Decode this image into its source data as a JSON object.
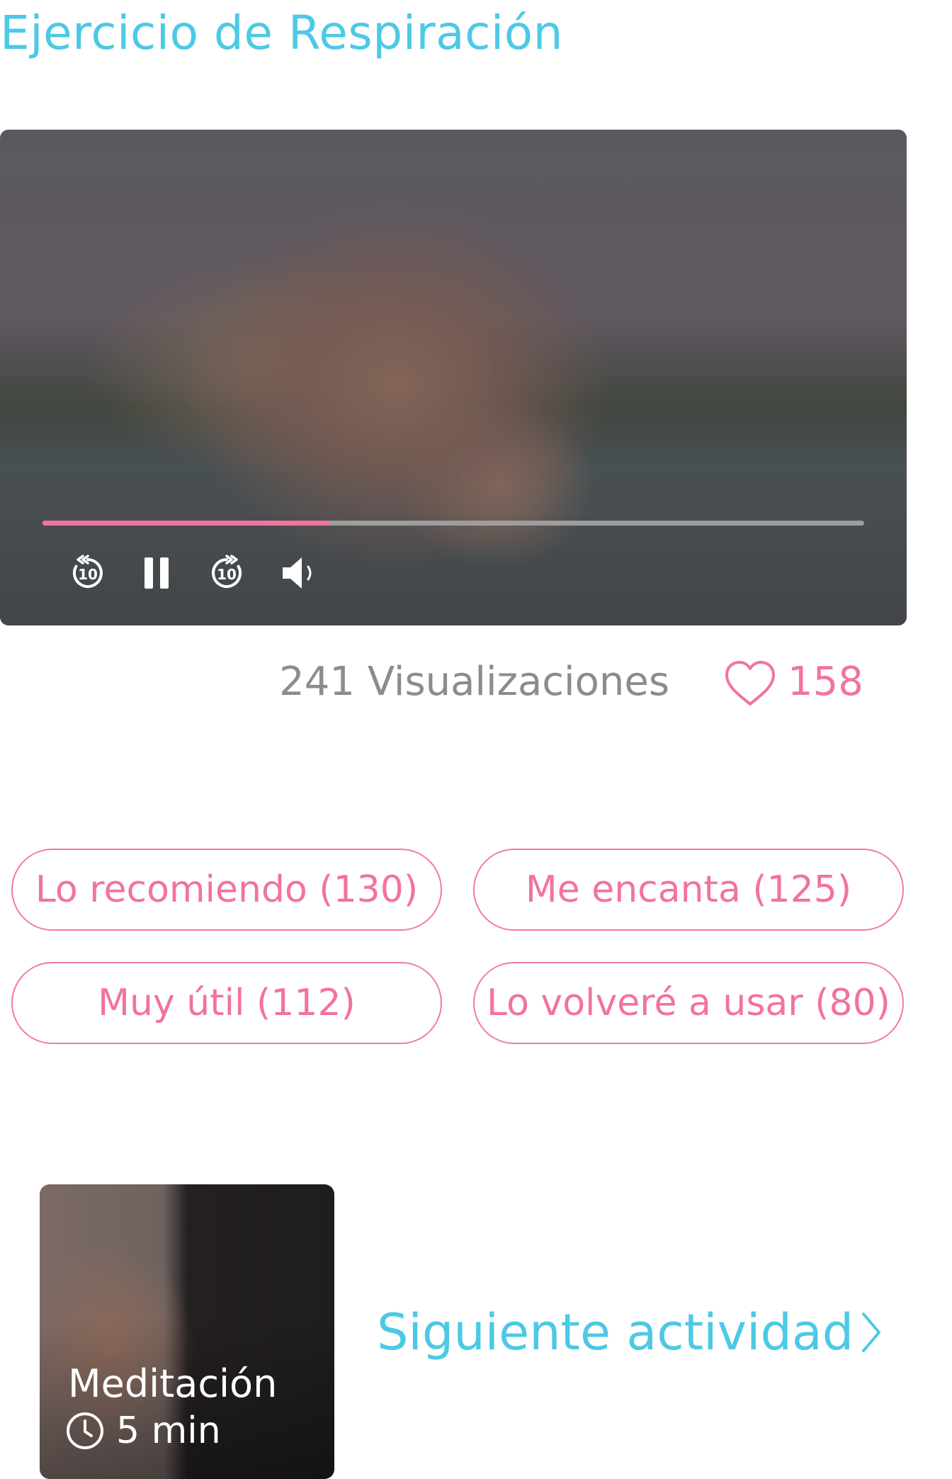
{
  "page": {
    "title": "Ejercicio de Respiración"
  },
  "player": {
    "progress_fraction": 0.35,
    "controls": [
      "replay-10-icon",
      "pause-icon",
      "forward-10-icon",
      "volume-icon"
    ],
    "accent_color": "#f2739e"
  },
  "stats": {
    "views_label": "241 Visualizaciones",
    "likes_count": "158"
  },
  "reactions": [
    {
      "label": "Lo recomiendo (130)"
    },
    {
      "label": "Me encanta (125)"
    },
    {
      "label": "Muy útil (112)"
    },
    {
      "label": "Lo volveré a usar (80)"
    }
  ],
  "next_activity": {
    "card_title": "Meditación",
    "duration": "5 min",
    "link_label": "Siguiente actividad"
  },
  "colors": {
    "title": "#4cc9e5",
    "pink": "#f2739e",
    "gray_text": "#8c8c8c"
  }
}
